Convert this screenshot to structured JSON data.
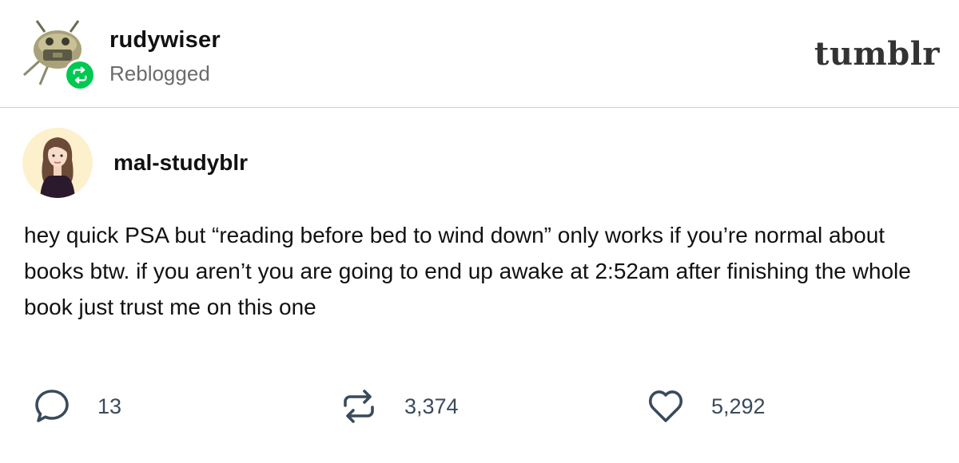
{
  "reblog": {
    "username": "rudywiser",
    "status": "Reblogged"
  },
  "brand": {
    "logo_text": "tumblr"
  },
  "post": {
    "author": "mal-studyblr",
    "text": "hey quick PSA but “reading before bed to wind down” only works if you’re normal about books btw. if you aren’t you are going to end up awake at 2:52am after finishing the whole book just trust me on this one"
  },
  "actions": {
    "comments": "13",
    "reblogs": "3,374",
    "likes": "5,292"
  },
  "icons": {
    "reblog_badge": "reblog-icon",
    "comment": "comment-bubble-icon",
    "reblog": "reblog-arrows-icon",
    "like": "heart-icon"
  },
  "colors": {
    "reblog_badge_green": "#00c853",
    "icon_gray": "#3a4a5c",
    "divider": "#cfcfcf"
  }
}
